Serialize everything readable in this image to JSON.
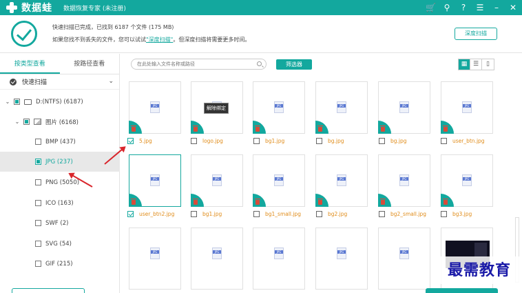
{
  "app": {
    "brand": "数据蛙",
    "subtitle": "数据恢复专家 (未注册)"
  },
  "titlebar_icons": [
    "cart-icon",
    "pin-icon",
    "help-icon",
    "menu-icon",
    "minimize-icon",
    "close-icon"
  ],
  "status": {
    "line1": "快速扫描已完成，已找到 6187 个文件 (175 MB)",
    "line2_prefix": "如果您找不到丢失的文件，您可以试试",
    "line2_link": "\"深度扫描\"",
    "line2_suffix": "。但深度扫描将需要更多时间。",
    "deep_scan_button": "深度扫描"
  },
  "sidebar": {
    "tabs": [
      {
        "label": "按类型查看",
        "active": true
      },
      {
        "label": "按路径查看",
        "active": false
      }
    ],
    "scan_label": "快速扫描",
    "tree": [
      {
        "label": "D:(NTFS) (6187)"
      },
      {
        "label": "图片 (6168)"
      },
      {
        "label": "BMP (437)"
      },
      {
        "label": "JPG (237)"
      },
      {
        "label": "PNG (5050)"
      },
      {
        "label": "ICO (163)"
      },
      {
        "label": "SWF (2)"
      },
      {
        "label": "SVG (54)"
      },
      {
        "label": "GIF (215)"
      }
    ]
  },
  "toolbar": {
    "search_placeholder": "在此处输入文件名称或路径",
    "filter_button": "筛选器",
    "view_modes": [
      "grid",
      "list",
      "detail"
    ]
  },
  "cards": [
    {
      "name": "5.jpg",
      "checked": true
    },
    {
      "name": "logo.jpg",
      "checked": false,
      "tooltip": "解除绑定"
    },
    {
      "name": "bg1.jpg",
      "checked": false
    },
    {
      "name": "bg.jpg",
      "checked": false
    },
    {
      "name": "bg.jpg",
      "checked": false
    },
    {
      "name": "user_btn.jpg",
      "checked": false
    },
    {
      "name": "user_btn2.jpg",
      "checked": true
    },
    {
      "name": "bg1.jpg",
      "checked": false
    },
    {
      "name": "bg1_small.jpg",
      "checked": false
    },
    {
      "name": "bg2.jpg",
      "checked": false
    },
    {
      "name": "bg2_small.jpg",
      "checked": false
    },
    {
      "name": "bg3.jpg",
      "checked": false
    }
  ],
  "icon_badge": "JPG",
  "watermark": "最需教育",
  "colors": {
    "accent": "#13a89e",
    "filename": "#e08c1a",
    "arrow": "#d9262c",
    "trash": "#d84b3a"
  }
}
